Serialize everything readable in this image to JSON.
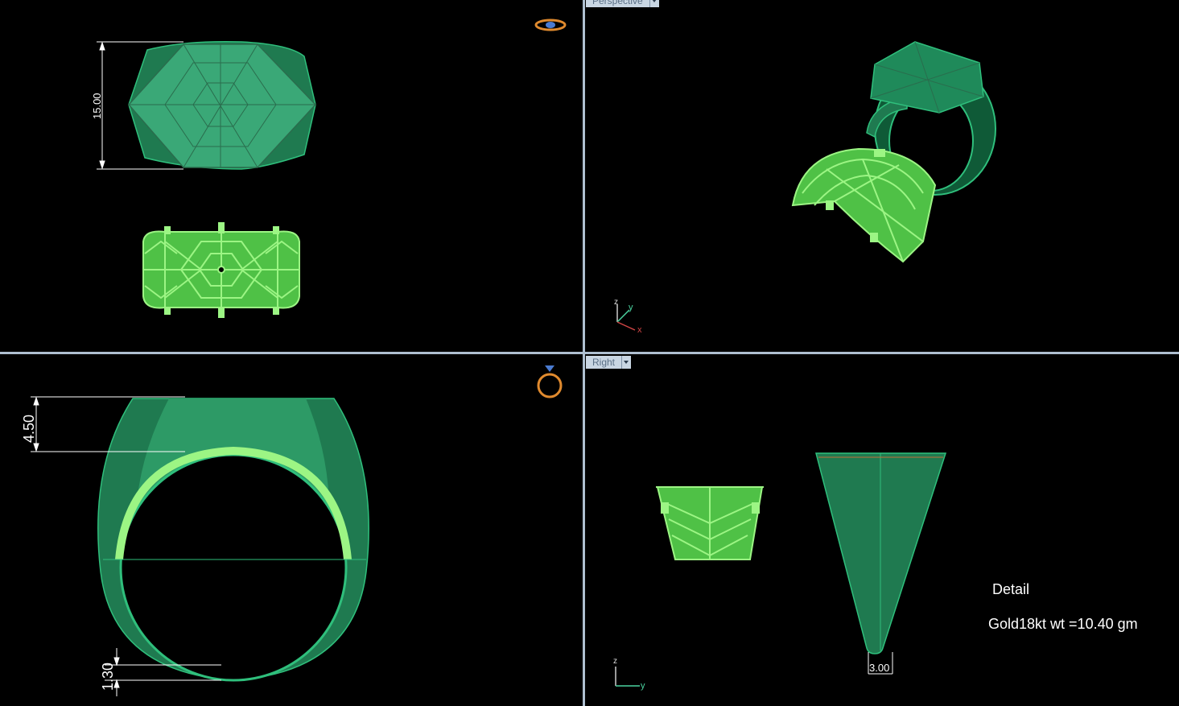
{
  "viewports": {
    "perspective": {
      "label": "Perspective"
    },
    "right": {
      "label": "Right"
    }
  },
  "dimensions": {
    "top_width": "15.00",
    "front_top": "4.50",
    "front_bottom": "1.30",
    "right_bottom": "3.00"
  },
  "axes": {
    "x": "x",
    "y": "y",
    "z": "z"
  },
  "detail": {
    "title": "Detail",
    "weight": "Gold18kt wt =10.40 gm"
  },
  "colors": {
    "background": "#000000",
    "ring_body": "#1f8a5a",
    "wireframe": "#8ff07a",
    "dimension_line": "#ffffff",
    "divider": "#aebfd0",
    "tab_bg": "#c9d6e3",
    "gizmo_orange": "#e08a2e"
  },
  "icons": [
    "ring-top-icon",
    "ring-front-icon",
    "dropdown-arrow-icon"
  ]
}
